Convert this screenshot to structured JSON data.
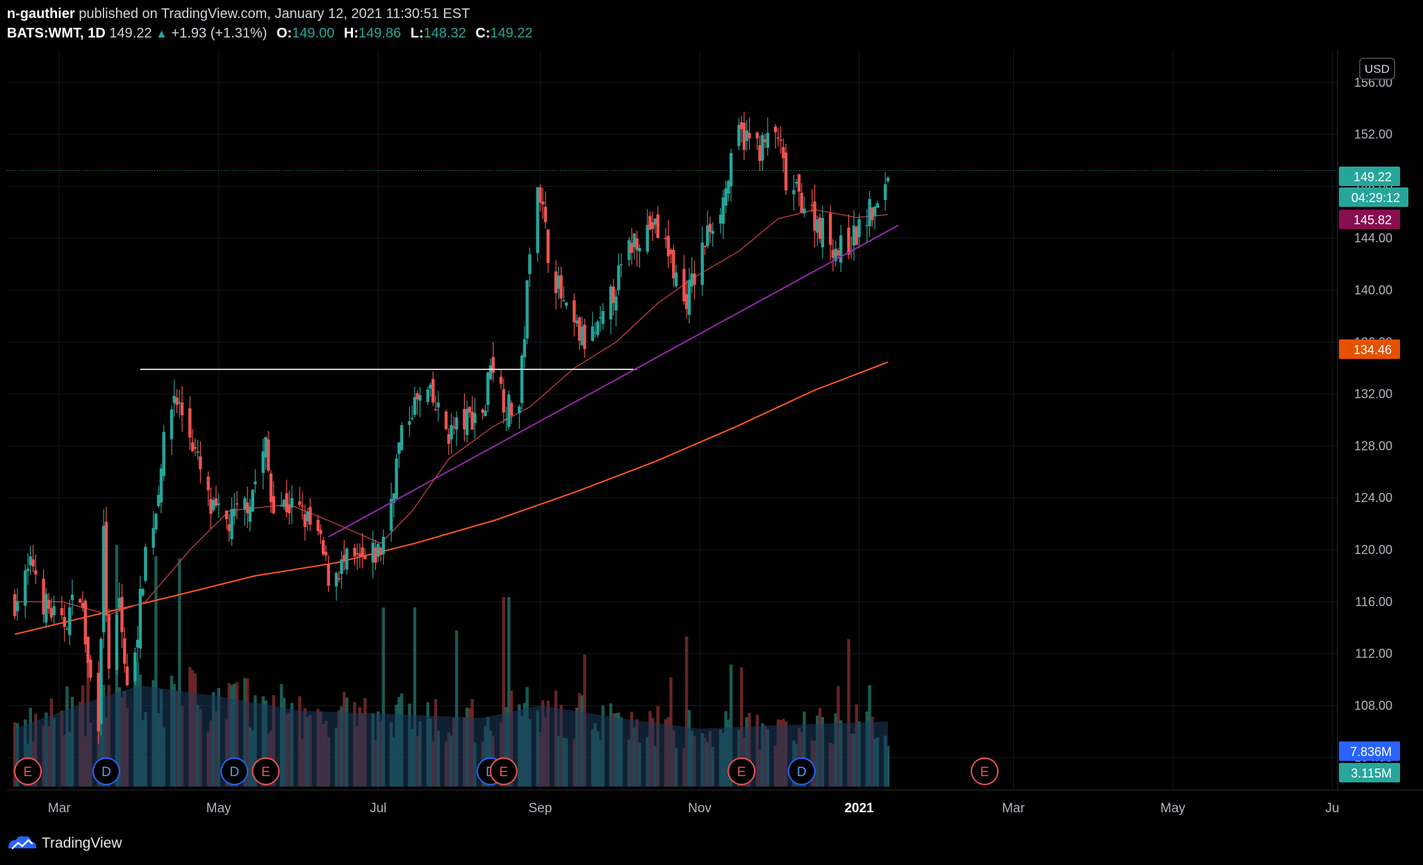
{
  "header": {
    "author": "n-gauthier",
    "published_text": "published on TradingView.com, January 12, 2021 11:30:51 EST",
    "symbol": "BATS:WMT, 1D",
    "last": "149.22",
    "change": "+1.93 (+1.31%)",
    "open_label": "O:",
    "open": "149.00",
    "high_label": "H:",
    "high": "149.86",
    "low_label": "L:",
    "low": "148.32",
    "close_label": "C:",
    "close": "149.22"
  },
  "footer": {
    "brand": "TradingView"
  },
  "colors": {
    "background": "#000000",
    "up": "#26a69a",
    "down": "#ef5350",
    "ma_short": "#b2393f",
    "ma_long": "#ff5722",
    "trendline": "#9c27b0",
    "resistance": "#ffffff",
    "volume_ma": "#1d3a5c"
  },
  "chart_data": {
    "type": "candlestick",
    "currency": "USD",
    "y_ticks": [
      "104.00",
      "108.00",
      "112.00",
      "116.00",
      "120.00",
      "124.00",
      "128.00",
      "132.00",
      "136.00",
      "140.00",
      "144.00",
      "148.00",
      "152.00",
      "156.00"
    ],
    "x_ticks": [
      "Mar",
      "May",
      "Jul",
      "Sep",
      "Nov",
      "2021",
      "Mar",
      "May",
      "Ju"
    ],
    "ylim": [
      101.5,
      158.5
    ],
    "price_badges": [
      {
        "label": "149.22",
        "value": 149.22,
        "color": "#26a69a"
      },
      {
        "label": "04:29:12",
        "value": 147.4,
        "color": "#26a69a"
      },
      {
        "label": "145.82",
        "value": 145.82,
        "color": "#880e4f"
      },
      {
        "label": "134.46",
        "value": 134.46,
        "color": "#e65100"
      },
      {
        "label": "7.836M",
        "value": 7.836,
        "color": "#2962ff"
      },
      {
        "label": "3.115M",
        "value": 3.115,
        "color": "#26a69a"
      }
    ],
    "events": [
      {
        "label": "E",
        "type": "earnings",
        "date": "2020-02-18"
      },
      {
        "label": "D",
        "type": "dividend",
        "date": "2020-03-19"
      },
      {
        "label": "D",
        "type": "dividend",
        "date": "2020-05-07"
      },
      {
        "label": "E",
        "type": "earnings",
        "date": "2020-05-19"
      },
      {
        "label": "D",
        "type": "dividend",
        "date": "2020-08-13"
      },
      {
        "label": "E",
        "type": "earnings",
        "date": "2020-08-18"
      },
      {
        "label": "E",
        "type": "earnings",
        "date": "2020-11-17"
      },
      {
        "label": "D",
        "type": "dividend",
        "date": "2020-12-10"
      },
      {
        "label": "E",
        "type": "earnings",
        "date": "2021-02-18"
      }
    ],
    "resistance_level": 133.9,
    "trendline": {
      "from": [
        "2020-06-12",
        121.0
      ],
      "to": [
        "2021-01-16",
        145.0
      ]
    },
    "close_path": [
      [
        "2020-02-13",
        116
      ],
      [
        "2020-02-20",
        119
      ],
      [
        "2020-02-24",
        116
      ],
      [
        "2020-03-02",
        114
      ],
      [
        "2020-03-09",
        117
      ],
      [
        "2020-03-12",
        111
      ],
      [
        "2020-03-16",
        107
      ],
      [
        "2020-03-18",
        121
      ],
      [
        "2020-03-20",
        110
      ],
      [
        "2020-03-24",
        116
      ],
      [
        "2020-03-27",
        109
      ],
      [
        "2020-03-31",
        114
      ],
      [
        "2020-04-03",
        120
      ],
      [
        "2020-04-07",
        123
      ],
      [
        "2020-04-09",
        127
      ],
      [
        "2020-04-14",
        132
      ],
      [
        "2020-04-20",
        129
      ],
      [
        "2020-04-24",
        126
      ],
      [
        "2020-04-28",
        123
      ],
      [
        "2020-05-05",
        122
      ],
      [
        "2020-05-13",
        124
      ],
      [
        "2020-05-19",
        128
      ],
      [
        "2020-05-21",
        124
      ],
      [
        "2020-06-01",
        123
      ],
      [
        "2020-06-08",
        121
      ],
      [
        "2020-06-12",
        118
      ],
      [
        "2020-06-19",
        119
      ],
      [
        "2020-06-26",
        119
      ],
      [
        "2020-07-02",
        120
      ],
      [
        "2020-07-06",
        124
      ],
      [
        "2020-07-09",
        128
      ],
      [
        "2020-07-14",
        131
      ],
      [
        "2020-07-20",
        132
      ],
      [
        "2020-07-28",
        129
      ],
      [
        "2020-08-04",
        130
      ],
      [
        "2020-08-11",
        131
      ],
      [
        "2020-08-13",
        135
      ],
      [
        "2020-08-19",
        131
      ],
      [
        "2020-08-24",
        131
      ],
      [
        "2020-08-27",
        140
      ],
      [
        "2020-08-31",
        149
      ],
      [
        "2020-09-04",
        143
      ],
      [
        "2020-09-11",
        138
      ],
      [
        "2020-09-18",
        136
      ],
      [
        "2020-09-24",
        137
      ],
      [
        "2020-10-01",
        141
      ],
      [
        "2020-10-07",
        144
      ],
      [
        "2020-10-14",
        145
      ],
      [
        "2020-10-20",
        143
      ],
      [
        "2020-10-26",
        139
      ],
      [
        "2020-10-30",
        141
      ],
      [
        "2020-11-05",
        145
      ],
      [
        "2020-11-10",
        147
      ],
      [
        "2020-11-16",
        152
      ],
      [
        "2020-11-24",
        151
      ],
      [
        "2020-12-01",
        152
      ],
      [
        "2020-12-04",
        148
      ],
      [
        "2020-12-10",
        147
      ],
      [
        "2020-12-17",
        145
      ],
      [
        "2020-12-24",
        143
      ],
      [
        "2020-12-30",
        144
      ],
      [
        "2021-01-05",
        146
      ],
      [
        "2021-01-08",
        146
      ],
      [
        "2021-01-12",
        149.22
      ]
    ],
    "ma_short_path": [
      [
        "2020-02-13",
        116
      ],
      [
        "2020-03-02",
        116
      ],
      [
        "2020-03-20",
        115
      ],
      [
        "2020-04-03",
        116
      ],
      [
        "2020-04-20",
        120
      ],
      [
        "2020-05-05",
        123
      ],
      [
        "2020-05-28",
        123.5
      ],
      [
        "2020-06-15",
        122
      ],
      [
        "2020-07-02",
        120.5
      ],
      [
        "2020-07-14",
        123
      ],
      [
        "2020-07-28",
        127
      ],
      [
        "2020-08-14",
        129.5
      ],
      [
        "2020-08-28",
        131
      ],
      [
        "2020-09-14",
        134
      ],
      [
        "2020-09-30",
        136
      ],
      [
        "2020-10-16",
        139
      ],
      [
        "2020-10-30",
        141
      ],
      [
        "2020-11-16",
        143
      ],
      [
        "2020-12-01",
        145.5
      ],
      [
        "2020-12-15",
        146.2
      ],
      [
        "2020-12-31",
        145.6
      ],
      [
        "2021-01-12",
        145.82
      ]
    ],
    "ma_long_path": [
      [
        "2020-02-13",
        113.5
      ],
      [
        "2020-03-15",
        115
      ],
      [
        "2020-04-15",
        116.5
      ],
      [
        "2020-05-15",
        118
      ],
      [
        "2020-06-15",
        119
      ],
      [
        "2020-07-15",
        120.5
      ],
      [
        "2020-08-15",
        122.3
      ],
      [
        "2020-09-15",
        124.5
      ],
      [
        "2020-10-15",
        126.8
      ],
      [
        "2020-11-15",
        129.5
      ],
      [
        "2020-12-15",
        132.3
      ],
      [
        "2021-01-12",
        134.46
      ]
    ],
    "volume_ma_path": [
      [
        "2020-02-13",
        3.2
      ],
      [
        "2020-03-10",
        4.6
      ],
      [
        "2020-04-01",
        5.6
      ],
      [
        "2020-05-01",
        5.0
      ],
      [
        "2020-06-01",
        4.2
      ],
      [
        "2020-07-10",
        4.0
      ],
      [
        "2020-08-10",
        3.8
      ],
      [
        "2020-09-01",
        4.5
      ],
      [
        "2020-10-01",
        3.8
      ],
      [
        "2020-11-01",
        3.2
      ],
      [
        "2020-12-01",
        3.4
      ],
      [
        "2021-01-12",
        3.6
      ]
    ]
  }
}
